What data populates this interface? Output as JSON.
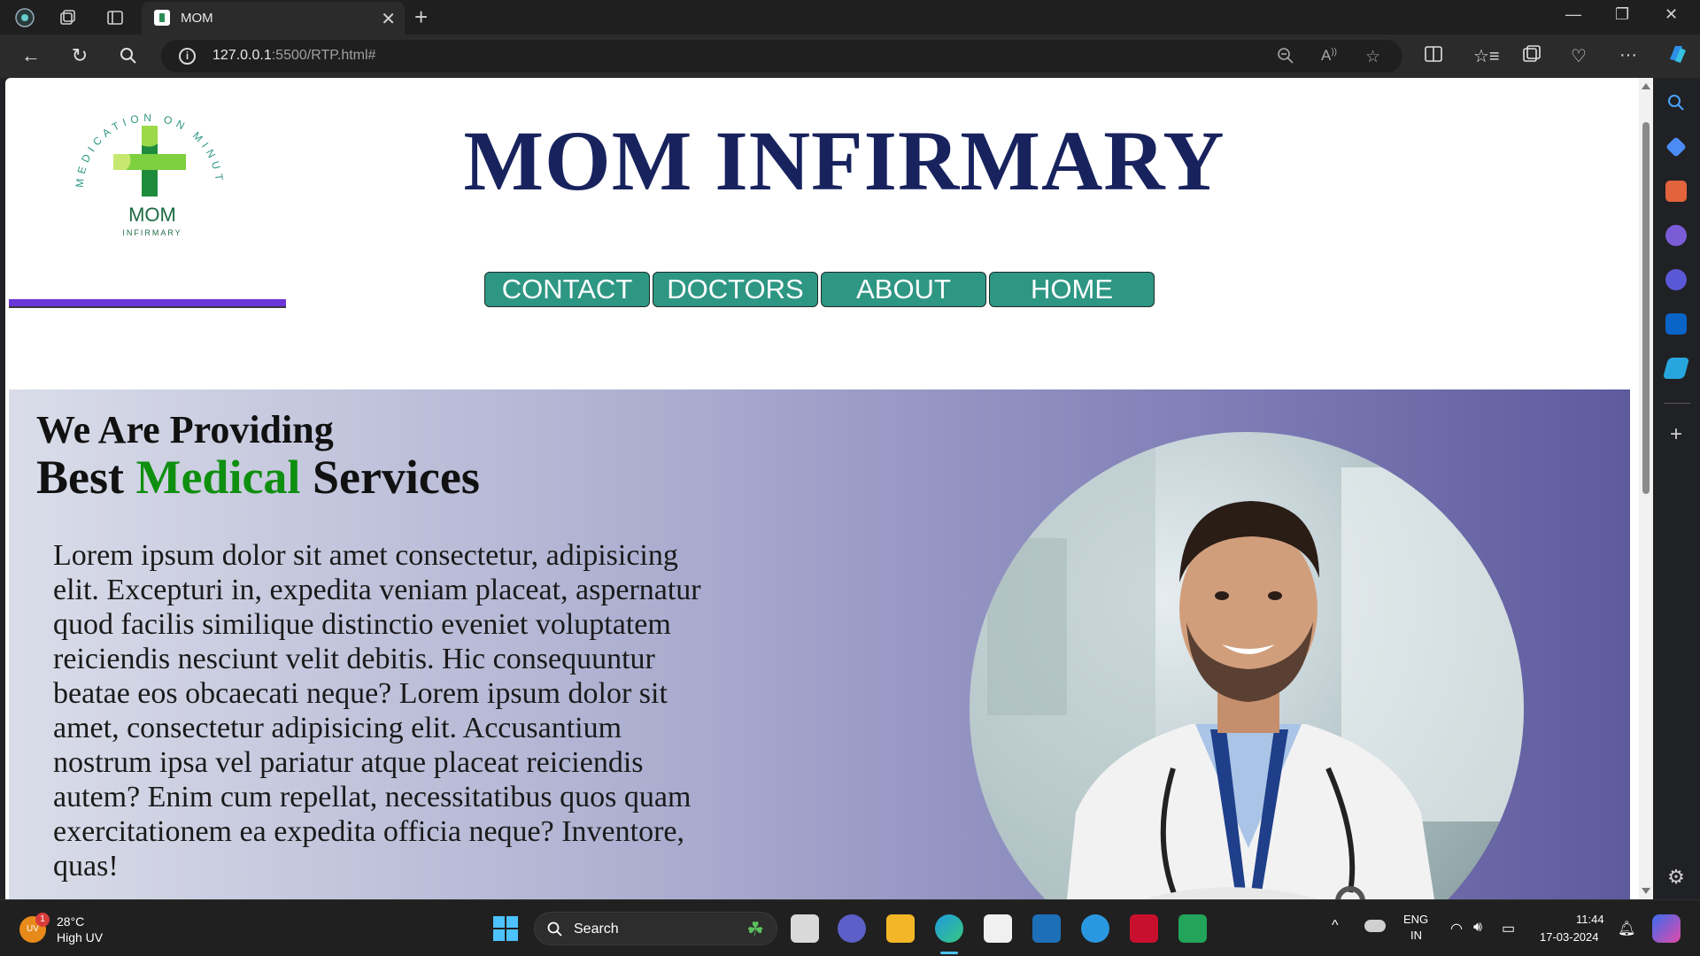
{
  "browser": {
    "tab_title": "MOM",
    "url_host": "127.0.0.1",
    "url_rest": ":5500/RTP.html#"
  },
  "page": {
    "logo": {
      "arc_text": "MEDICATION ON MINUTE",
      "name": "MOM",
      "sub": "INFIRMARY"
    },
    "title": "MOM INFIRMARY",
    "nav": [
      {
        "label": "CONTACT"
      },
      {
        "label": "DOCTORS"
      },
      {
        "label": "ABOUT"
      },
      {
        "label": "HOME"
      }
    ],
    "hero": {
      "line1": "We Are Providing",
      "line2_a": "Best ",
      "line2_b": "Medical",
      "line2_c": " Services",
      "paragraph": "Lorem ipsum dolor sit amet consectetur, adipisicing elit. Excepturi in, expedita veniam placeat, aspernatur quod facilis similique distinctio eveniet voluptatem reiciendis nesciunt velit debitis. Hic consequuntur beatae eos obcaecati neque? Lorem ipsum dolor sit amet, consectetur adipisicing elit. Accusantium nostrum ipsa vel pariatur atque placeat reiciendis autem? Enim cum repellat, necessitatibus quos quam exercitationem ea expedita officia neque? Inventore, quas!"
    }
  },
  "taskbar": {
    "weather_temp": "28°C",
    "weather_desc": "High UV",
    "weather_badge": "1",
    "weather_icon_text": "UV",
    "search_label": "Search",
    "lang_top": "ENG",
    "lang_bottom": "IN",
    "time": "11:44",
    "date": "17-03-2024"
  },
  "colors": {
    "title": "#18235e",
    "nav_button": "#2e9784",
    "accent_bar": "#6a36d9",
    "highlight": "#0f8f0f"
  }
}
